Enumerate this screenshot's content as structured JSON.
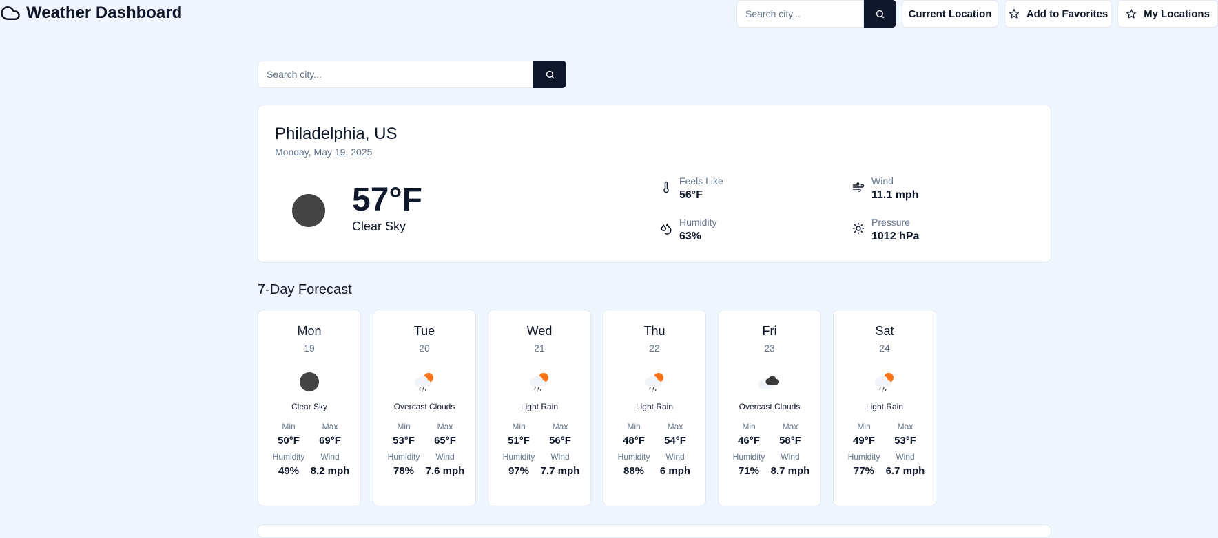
{
  "header": {
    "title": "Weather Dashboard",
    "search_placeholder": "Search city...",
    "current_location": "Current Location",
    "add_favorites": "Add to Favorites",
    "my_locations": "My Locations"
  },
  "main_search": {
    "placeholder": "Search city..."
  },
  "current": {
    "city": "Philadelphia, US",
    "date": "Monday, May 19, 2025",
    "temperature": "57°F",
    "condition": "Clear Sky",
    "feels_like": {
      "label": "Feels Like",
      "value": "56°F"
    },
    "wind": {
      "label": "Wind",
      "value": "11.1 mph"
    },
    "humidity": {
      "label": "Humidity",
      "value": "63%"
    },
    "pressure": {
      "label": "Pressure",
      "value": "1012 hPa"
    }
  },
  "forecast": {
    "title": "7-Day Forecast",
    "labels": {
      "min": "Min",
      "max": "Max",
      "humidity": "Humidity",
      "wind": "Wind"
    },
    "days": [
      {
        "day": "Mon",
        "date": "19",
        "icon": "clear-icon",
        "condition": "Clear Sky",
        "min": "50°F",
        "max": "69°F",
        "humidity": "49%",
        "wind": "8.2 mph"
      },
      {
        "day": "Tue",
        "date": "20",
        "icon": "rain-icon",
        "condition": "Overcast Clouds",
        "min": "53°F",
        "max": "65°F",
        "humidity": "78%",
        "wind": "7.6 mph"
      },
      {
        "day": "Wed",
        "date": "21",
        "icon": "rain-icon",
        "condition": "Light Rain",
        "min": "51°F",
        "max": "56°F",
        "humidity": "97%",
        "wind": "7.7 mph"
      },
      {
        "day": "Thu",
        "date": "22",
        "icon": "rain-icon",
        "condition": "Light Rain",
        "min": "48°F",
        "max": "54°F",
        "humidity": "88%",
        "wind": "6 mph"
      },
      {
        "day": "Fri",
        "date": "23",
        "icon": "clouds-icon",
        "condition": "Overcast Clouds",
        "min": "46°F",
        "max": "58°F",
        "humidity": "71%",
        "wind": "8.7 mph"
      },
      {
        "day": "Sat",
        "date": "24",
        "icon": "rain-icon",
        "condition": "Light Rain",
        "min": "49°F",
        "max": "53°F",
        "humidity": "77%",
        "wind": "6.7 mph"
      }
    ]
  },
  "colors": {
    "background": "#eff6ff",
    "dark": "#0f172a",
    "muted": "#64748b",
    "sun_orange": "#f97316"
  }
}
